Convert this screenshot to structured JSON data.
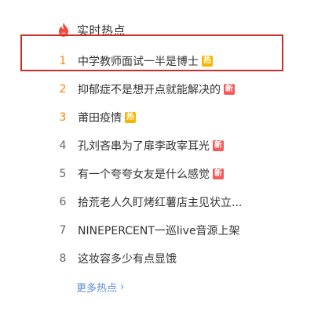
{
  "header": {
    "icon": "flame-icon",
    "title": "实时热点"
  },
  "colors": {
    "accent_rank": "#ff8200",
    "hot_badge": "#f7b500",
    "new_badge": "#f35959",
    "link": "#5b8bd5",
    "highlight_box": "#c9302c"
  },
  "items": [
    {
      "rank": "1",
      "title": "中学教师面试一半是博士",
      "badge": "热"
    },
    {
      "rank": "2",
      "title": "抑郁症不是想开点就能解决的",
      "badge": "新"
    },
    {
      "rank": "3",
      "title": "莆田疫情",
      "badge": "热"
    },
    {
      "rank": "4",
      "title": "孔刘吝串为了扉李政宰耳光",
      "badge": "新"
    },
    {
      "rank": "5",
      "title": "有一个夸夸女友是什么感觉",
      "badge": "新"
    },
    {
      "rank": "6",
      "title": "拾荒老人久盯烤红薯店主见状立...",
      "badge": ""
    },
    {
      "rank": "7",
      "title": "NINEPERCENT一巡live音源上架",
      "badge": ""
    },
    {
      "rank": "8",
      "title": "这妆容多少有点显饿",
      "badge": ""
    }
  ],
  "more": {
    "label": "更多热点",
    "chevron": "›"
  }
}
